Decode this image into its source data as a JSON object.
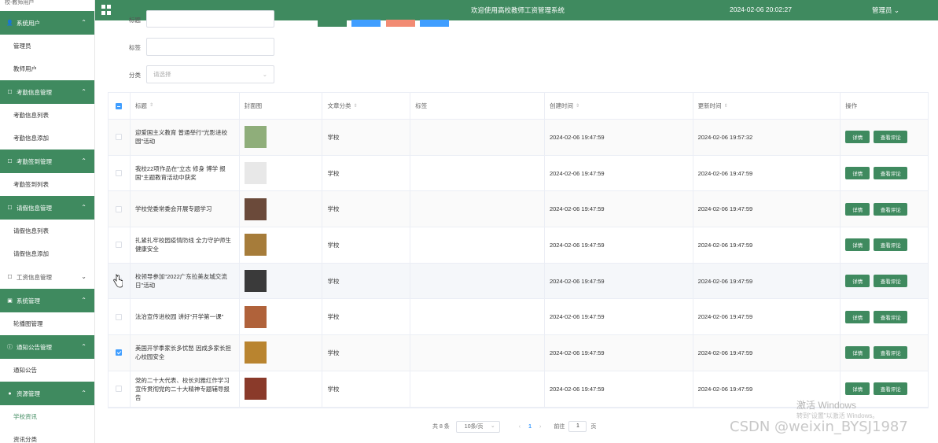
{
  "sidebar": {
    "top_label": "校-教师用户",
    "groups": [
      {
        "label": "系统用户",
        "icon": "user-icon",
        "expanded": true,
        "items": [
          "管理员",
          "教师用户"
        ]
      },
      {
        "label": "考勤信息管理",
        "icon": "edit-icon",
        "expanded": true,
        "items": [
          "考勤信息列表",
          "考勤信息添加"
        ]
      },
      {
        "label": "考勤签到管理",
        "icon": "edit-icon",
        "expanded": true,
        "items": [
          "考勤签到列表"
        ]
      },
      {
        "label": "请假信息管理",
        "icon": "edit-icon",
        "expanded": true,
        "items": [
          "请假信息列表",
          "请假信息添加"
        ]
      },
      {
        "label": "工资信息管理",
        "icon": "edit-icon",
        "expanded": false,
        "items": []
      },
      {
        "label": "系统管理",
        "icon": "image-icon",
        "expanded": true,
        "items": [
          "轮播图管理"
        ]
      },
      {
        "label": "通知公告管理",
        "icon": "info-icon",
        "expanded": true,
        "items": [
          "通知公告"
        ]
      },
      {
        "label": "资源管理",
        "icon": "pin-icon",
        "expanded": true,
        "items": [
          "学校资讯",
          "资讯分类"
        ]
      }
    ],
    "active_item": "学校资讯"
  },
  "header": {
    "title": "欢迎使用高校教师工资管理系统",
    "datetime": "2024-02-06 20:02:27",
    "user": "管理员 ⌄"
  },
  "search": {
    "title_label": "标题",
    "tag_label": "标签",
    "category_label": "分类",
    "category_placeholder": "请选择"
  },
  "table": {
    "columns": [
      "标题",
      "封面图",
      "文章分类",
      "标签",
      "创建时间",
      "更新时间",
      "操作"
    ],
    "detail_label": "详情",
    "comment_label": "查看评论",
    "rows": [
      {
        "title": "迎爱国主义教育 普通举行\"光影进校园\"活动",
        "category": "学校",
        "tag": "",
        "created": "2024-02-06 19:47:59",
        "updated": "2024-02-06 19:57:32",
        "checked": false,
        "thumb": "#8fae7a"
      },
      {
        "title": "我校22项作品在\"立志 修身 博学 报国\"主题教育活动中获奖",
        "category": "学校",
        "tag": "",
        "created": "2024-02-06 19:47:59",
        "updated": "2024-02-06 19:47:59",
        "checked": false,
        "thumb": "#e8e8e8"
      },
      {
        "title": "学校党委常委会开展专题学习",
        "category": "学校",
        "tag": "",
        "created": "2024-02-06 19:47:59",
        "updated": "2024-02-06 19:47:59",
        "checked": false,
        "thumb": "#6b4a3a"
      },
      {
        "title": "扎紧扎牢校园疫情防线 全力守护师生健康安全",
        "category": "学校",
        "tag": "",
        "created": "2024-02-06 19:47:59",
        "updated": "2024-02-06 19:47:59",
        "checked": false,
        "thumb": "#a67c3a"
      },
      {
        "title": "校领导参加\"2022广东拉美友城交流日\"活动",
        "category": "学校",
        "tag": "",
        "created": "2024-02-06 19:47:59",
        "updated": "2024-02-06 19:47:59",
        "checked": false,
        "thumb": "#3a3a3a"
      },
      {
        "title": "法治宣传进校园 讲好\"开学第一课\"",
        "category": "学校",
        "tag": "",
        "created": "2024-02-06 19:47:59",
        "updated": "2024-02-06 19:47:59",
        "checked": false,
        "thumb": "#b0623a"
      },
      {
        "title": "美国开学季家长多忧愁 因成多家长担心校园安全",
        "category": "学校",
        "tag": "",
        "created": "2024-02-06 19:47:59",
        "updated": "2024-02-06 19:47:59",
        "checked": true,
        "thumb": "#b9842f"
      },
      {
        "title": "党的二十大代表、校长刘雅红作学习宣传贯彻党的二十大精神专题辅导报告",
        "category": "学校",
        "tag": "",
        "created": "2024-02-06 19:47:59",
        "updated": "2024-02-06 19:47:59",
        "checked": false,
        "thumb": "#8a3a2a"
      }
    ]
  },
  "pagination": {
    "total": "共 8 条",
    "page_size": "10条/页",
    "prev": "‹",
    "current": "1",
    "next": "›",
    "goto_label": "前往",
    "goto_value": "1",
    "page_suffix": "页"
  },
  "overlay": {
    "watermark_line1": "激活 Windows",
    "watermark_line2": "转到\"设置\"以激活 Windows。",
    "csdn": "CSDN @weixin_BYSJ1987"
  },
  "colors": {
    "primary": "#3f8a5f",
    "blue": "#409eff",
    "salmon": "#f28b73"
  }
}
